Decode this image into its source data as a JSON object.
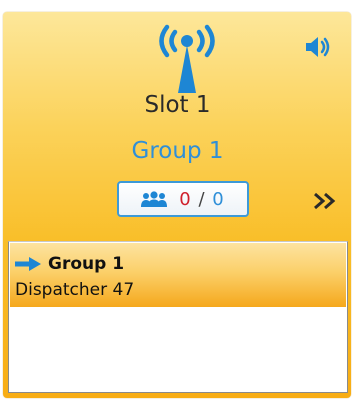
{
  "slot": {
    "label": "Slot 1",
    "group": "Group 1",
    "counter": {
      "active": "0",
      "separator": "/",
      "total": "0"
    }
  },
  "active_call": {
    "group": "Group 1",
    "caller": "Dispatcher 47"
  },
  "icons": {
    "radio_tower": "radio-tower-icon",
    "speaker": "speaker-icon",
    "people": "people-icon",
    "expand": "double-chevron-right-icon",
    "call_arrow": "arrow-right-icon"
  },
  "colors": {
    "tile_gradient_top": "#fde79a",
    "tile_gradient_bottom": "#f8ad14",
    "accent_blue": "#2f8fd8",
    "active_count_red": "#d0202c"
  }
}
